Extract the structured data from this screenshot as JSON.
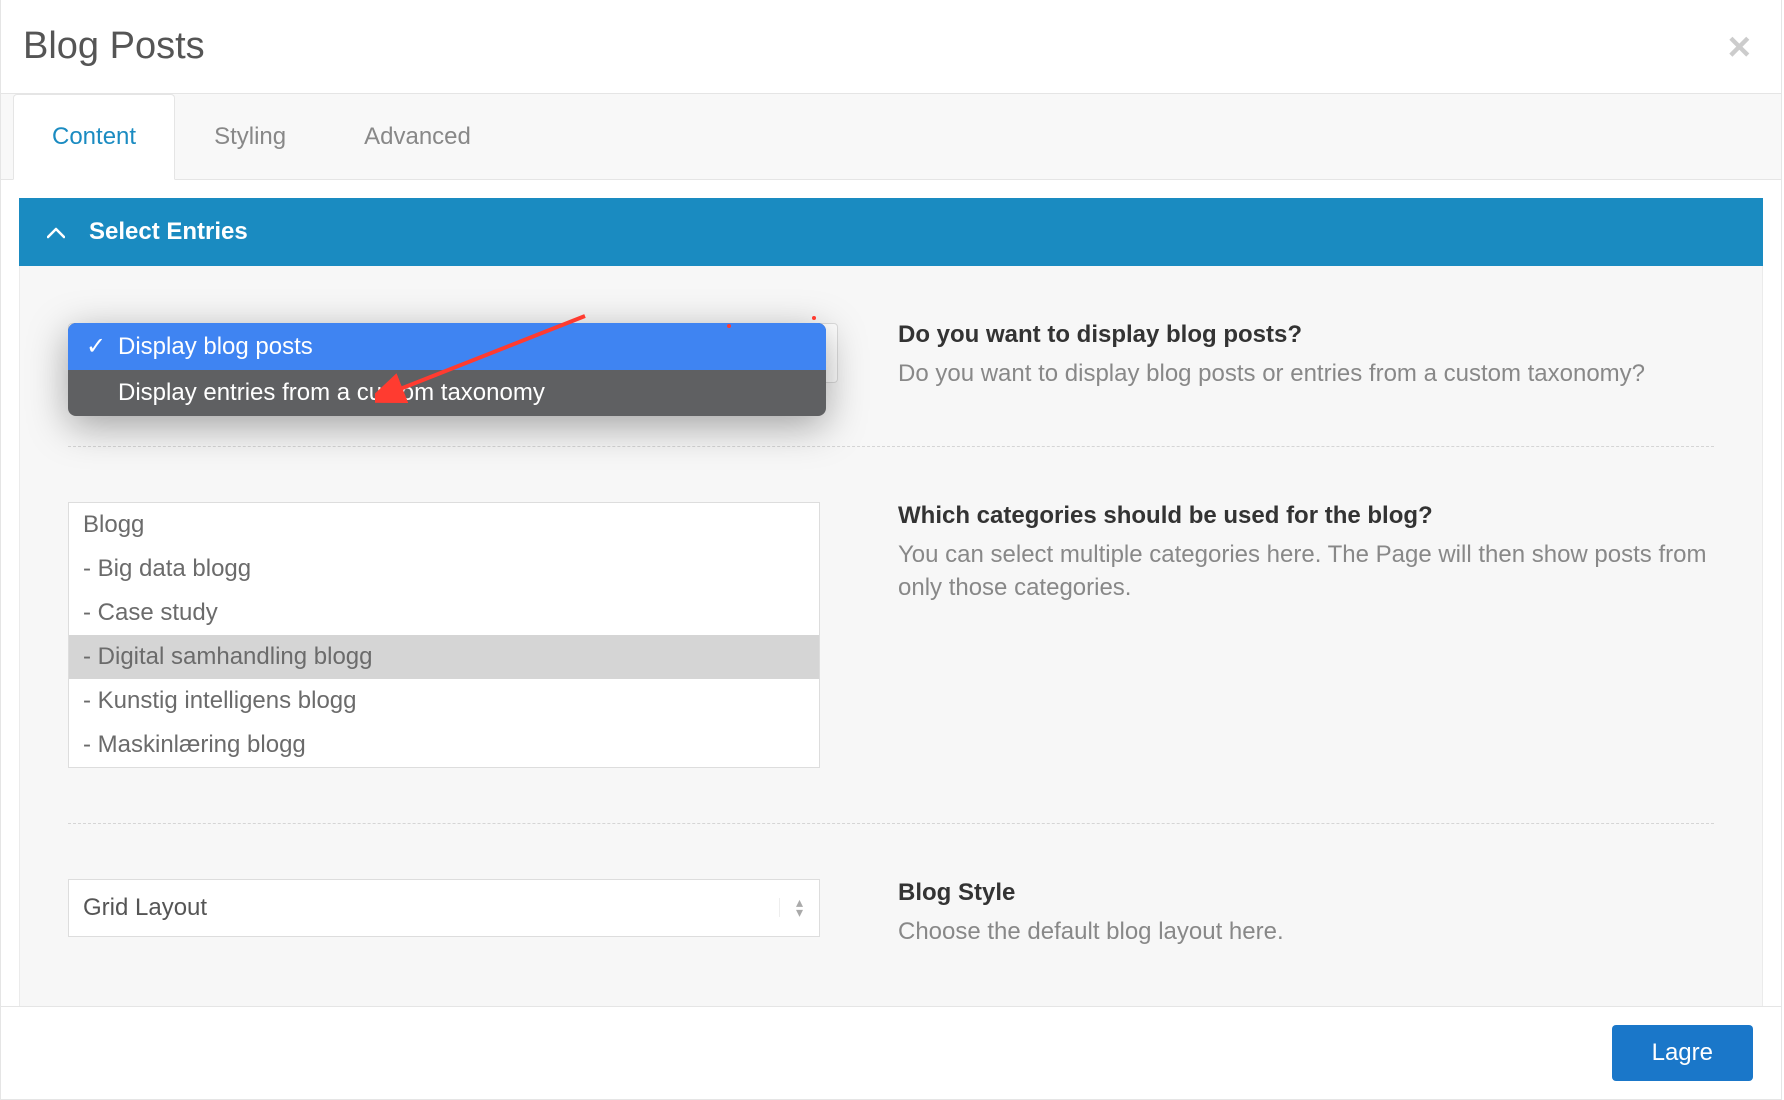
{
  "modal": {
    "title": "Blog Posts"
  },
  "tabs": {
    "content": "Content",
    "styling": "Styling",
    "advanced": "Advanced"
  },
  "accordion": {
    "select_entries": "Select Entries"
  },
  "row1": {
    "label": "Do you want to display blog posts?",
    "desc": "Do you want to display blog posts or entries from a custom taxonomy?",
    "options": {
      "blog_posts": "Display blog posts",
      "custom_taxonomy": "Display entries from a custom taxonomy"
    }
  },
  "row2": {
    "label": "Which categories should be used for the blog?",
    "desc": "You can select multiple categories here. The Page will then show posts from only those categories.",
    "items": {
      "i0": "Blogg",
      "i1": "  - Big data blogg",
      "i2": "  - Case study",
      "i3": "  - Digital samhandling blogg",
      "i4": "  - Kunstig intelligens blogg",
      "i5": "  - Maskinlæring blogg"
    }
  },
  "row3": {
    "label": "Blog Style",
    "desc": "Choose the default blog layout here.",
    "value": "Grid Layout"
  },
  "footer": {
    "save": "Lagre"
  }
}
